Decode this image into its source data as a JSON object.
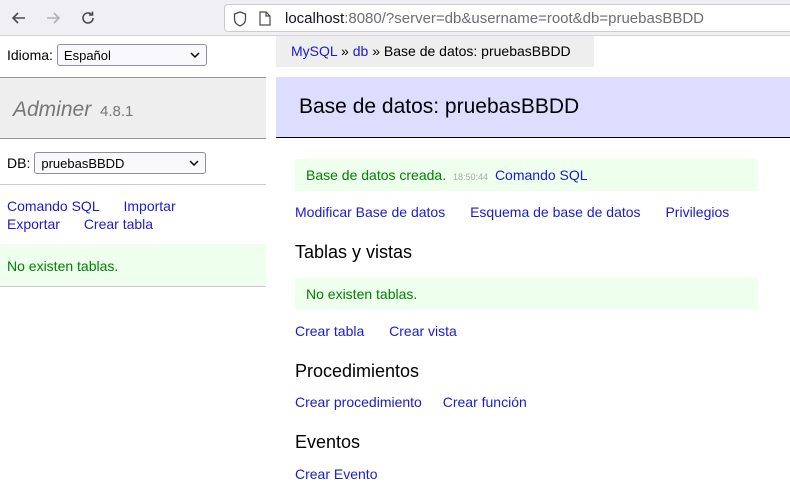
{
  "browser": {
    "url_host": "localhost",
    "url_rest": ":8080/?server=db&username=root&db=pruebasBBDD"
  },
  "sidebar": {
    "lang_label": "Idioma:",
    "lang_value": "Español",
    "brand_name": "Adminer",
    "brand_version": "4.8.1",
    "db_label": "DB:",
    "db_value": "pruebasBBDD",
    "links": {
      "sql_command": "Comando SQL",
      "import": "Importar",
      "export": "Exportar",
      "create_table": "Crear tabla"
    },
    "message": "No existen tablas."
  },
  "breadcrumb": {
    "server": "MySQL",
    "sep1": " » ",
    "db": "db",
    "sep2": " » ",
    "current": "Base de datos: pruebasBBDD"
  },
  "main": {
    "title": "Base de datos: pruebasBBDD",
    "message": {
      "text": "Base de datos creada.",
      "time": "18:50:44",
      "link": "Comando SQL"
    },
    "actions": {
      "modify": "Modificar Base de datos",
      "schema": "Esquema de base de datos",
      "privileges": "Privilegios"
    },
    "tables": {
      "heading": "Tablas y vistas",
      "empty": "No existen tablas.",
      "create_table": "Crear tabla",
      "create_view": "Crear vista"
    },
    "routines": {
      "heading": "Procedimientos",
      "create_procedure": "Crear procedimiento",
      "create_function": "Crear función"
    },
    "events": {
      "heading": "Eventos",
      "create_event": "Crear Evento"
    }
  },
  "colors": {
    "link": "#1a1ad6",
    "success": "#008000",
    "success_bg": "#eeffee",
    "header_bg": "#ddddff"
  }
}
